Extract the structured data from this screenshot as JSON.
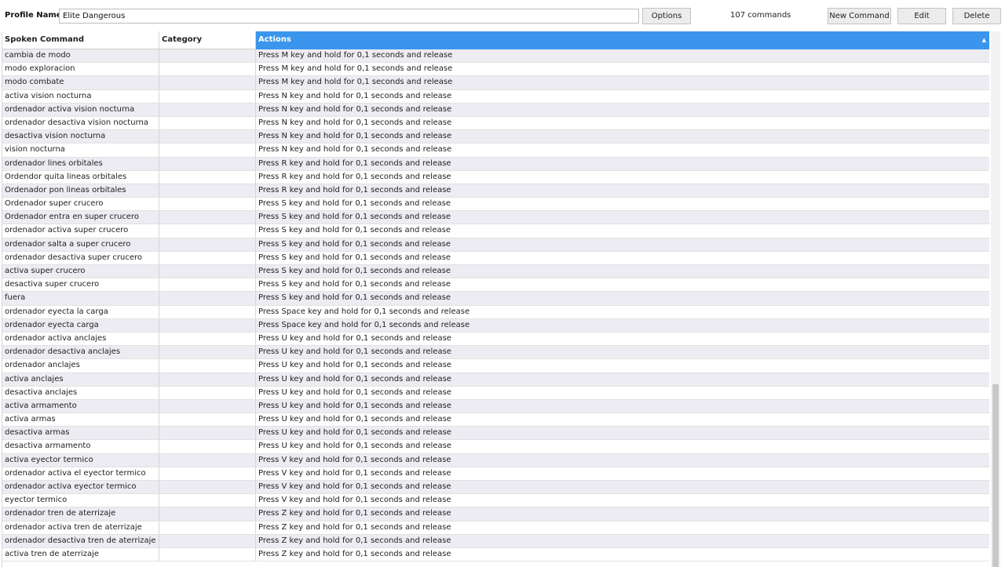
{
  "toolbar": {
    "profile_label": "Profile Name",
    "profile_value": "Elite Dangerous",
    "options_label": "Options",
    "command_count": "107 commands",
    "new_command_label": "New Command",
    "edit_label": "Edit",
    "delete_label": "Delete"
  },
  "grid": {
    "columns": [
      "Spoken Command",
      "Category",
      "Actions"
    ],
    "sorted_column": "Actions",
    "sort_indicator": "▲",
    "rows": [
      {
        "command": "cambia de modo",
        "category": "",
        "action": "Press M key and hold for 0,1 seconds and release"
      },
      {
        "command": "modo exploracion",
        "category": "",
        "action": "Press M key and hold for 0,1 seconds and release"
      },
      {
        "command": "modo combate",
        "category": "",
        "action": "Press M key and hold for 0,1 seconds and release"
      },
      {
        "command": "activa vision nocturna",
        "category": "",
        "action": "Press N key and hold for 0,1 seconds and release"
      },
      {
        "command": "ordenador activa vision nocturna",
        "category": "",
        "action": "Press N key and hold for 0,1 seconds and release"
      },
      {
        "command": "ordenador desactiva vision nocturna",
        "category": "",
        "action": "Press N key and hold for 0,1 seconds and release"
      },
      {
        "command": "desactiva vision nocturna",
        "category": "",
        "action": "Press N key and hold for 0,1 seconds and release"
      },
      {
        "command": "vision nocturna",
        "category": "",
        "action": "Press N key and hold for 0,1 seconds and release"
      },
      {
        "command": "ordenador lines orbitales",
        "category": "",
        "action": "Press R key and hold for 0,1 seconds and release"
      },
      {
        "command": "Ordendor quita lineas orbitales",
        "category": "",
        "action": "Press R key and hold for 0,1 seconds and release"
      },
      {
        "command": "Ordenador pon lineas orbitales",
        "category": "",
        "action": "Press R key and hold for 0,1 seconds and release"
      },
      {
        "command": "Ordenador super crucero",
        "category": "",
        "action": "Press S key and hold for 0,1 seconds and release"
      },
      {
        "command": "Ordenador entra en super crucero",
        "category": "",
        "action": "Press S key and hold for 0,1 seconds and release"
      },
      {
        "command": "ordenador activa super crucero",
        "category": "",
        "action": "Press S key and hold for 0,1 seconds and release"
      },
      {
        "command": "ordenador salta a super crucero",
        "category": "",
        "action": "Press S key and hold for 0,1 seconds and release"
      },
      {
        "command": "ordenador desactiva super crucero",
        "category": "",
        "action": "Press S key and hold for 0,1 seconds and release"
      },
      {
        "command": "activa super crucero",
        "category": "",
        "action": "Press S key and hold for 0,1 seconds and release"
      },
      {
        "command": "desactiva super crucero",
        "category": "",
        "action": "Press S key and hold for 0,1 seconds and release"
      },
      {
        "command": "fuera",
        "category": "",
        "action": "Press S key and hold for 0,1 seconds and release"
      },
      {
        "command": "ordenador eyecta la carga",
        "category": "",
        "action": "Press Space key and hold for 0,1 seconds and release"
      },
      {
        "command": "ordenador eyecta carga",
        "category": "",
        "action": "Press Space key and hold for 0,1 seconds and release"
      },
      {
        "command": "ordenador activa anclajes",
        "category": "",
        "action": "Press U key and hold for 0,1 seconds and release"
      },
      {
        "command": "ordenador desactiva anclajes",
        "category": "",
        "action": "Press U key and hold for 0,1 seconds and release"
      },
      {
        "command": "ordenador anclajes",
        "category": "",
        "action": "Press U key and hold for 0,1 seconds and release"
      },
      {
        "command": "activa anclajes",
        "category": "",
        "action": "Press U key and hold for 0,1 seconds and release"
      },
      {
        "command": "desactiva anclajes",
        "category": "",
        "action": "Press U key and hold for 0,1 seconds and release"
      },
      {
        "command": "activa armamento",
        "category": "",
        "action": "Press U key and hold for 0,1 seconds and release"
      },
      {
        "command": "activa armas",
        "category": "",
        "action": "Press U key and hold for 0,1 seconds and release"
      },
      {
        "command": "desactiva armas",
        "category": "",
        "action": "Press U key and hold for 0,1 seconds and release"
      },
      {
        "command": "desactiva armamento",
        "category": "",
        "action": "Press U key and hold for 0,1 seconds and release"
      },
      {
        "command": "activa eyector termico",
        "category": "",
        "action": "Press V key and hold for 0,1 seconds and release"
      },
      {
        "command": "ordenador activa el eyector termico",
        "category": "",
        "action": "Press V key and hold for 0,1 seconds and release"
      },
      {
        "command": "ordenador activa eyector termico",
        "category": "",
        "action": "Press V key and hold for 0,1 seconds and release"
      },
      {
        "command": "eyector termico",
        "category": "",
        "action": "Press V key and hold for 0,1 seconds and release"
      },
      {
        "command": "ordenador tren de aterrizaje",
        "category": "",
        "action": "Press Z key and hold for 0,1 seconds and release"
      },
      {
        "command": "ordenador activa tren de aterrizaje",
        "category": "",
        "action": "Press Z key and hold for 0,1 seconds and release"
      },
      {
        "command": "ordenador desactiva tren de aterrizaje",
        "category": "",
        "action": "Press Z key and hold for 0,1 seconds and release"
      },
      {
        "command": "activa tren de aterrizaje",
        "category": "",
        "action": "Press Z key and hold for 0,1 seconds and release"
      }
    ]
  }
}
